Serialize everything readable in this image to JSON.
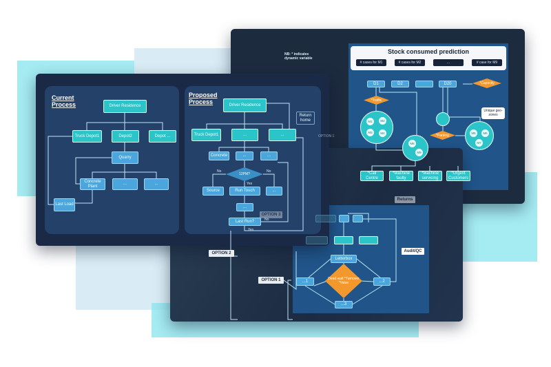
{
  "current": {
    "title": "Current Process",
    "nodes": [
      "Driver Residence",
      "Truck Depot1",
      "Depot2",
      "Depot ...",
      "Quarry",
      "Concrete Plant",
      "...",
      "...",
      "Last Load"
    ]
  },
  "proposed": {
    "title": "Proposed Process",
    "nodes": [
      "Driver Residence",
      "Truck Depot1",
      "...",
      "...",
      "Concrete",
      "...",
      "...",
      "12PM?",
      "Source",
      "Run Touch",
      "...",
      "...",
      "Last Run?"
    ],
    "edge_labels": {
      "no_left": "No",
      "no_right": "No",
      "yes": "Yes",
      "no_bottom": "No",
      "yes_bottom": "Yes"
    },
    "return_home": "Return home"
  },
  "notes": {
    "nb": "NB: * indicates dynamic variable",
    "option1": "OPTION 1",
    "option2": "OPTION 2",
    "option3": "OPTION 3",
    "returns": "Returns",
    "audit": "Audit/QC"
  },
  "stock": {
    "title": "Stock consumed prediction",
    "pills": [
      "# cases for M1",
      "# cases for M2",
      "...",
      "# case for M9"
    ],
    "days": [
      "D1",
      "D2",
      "",
      "D20"
    ],
    "traffic": "*Traffic",
    "capacity": "*Capacity",
    "parking": "*Parking",
    "geo": "Unique geo-zones",
    "circle1": [
      "M1",
      "M2",
      "M3",
      "M4"
    ],
    "circle2": [
      "M8",
      "M9"
    ],
    "circle3": [
      "M5",
      "M6",
      "M7"
    ],
    "outputs": [
      "*Call Centre",
      "*Machine faulty",
      "*Machine servicing",
      "*Urgent Customers"
    ]
  },
  "audit": {
    "letterbox": "Letterbox",
    "decision": "Dead wait *Turnover *Value",
    "n1": "...1",
    "n2": "...2",
    "n3": "...3"
  },
  "colors": {
    "teal": "#2bc4c9",
    "sky": "#4aa6dc",
    "orange": "#f2982c",
    "panel": "#1b2b48",
    "glow": "#8fe6ef"
  }
}
